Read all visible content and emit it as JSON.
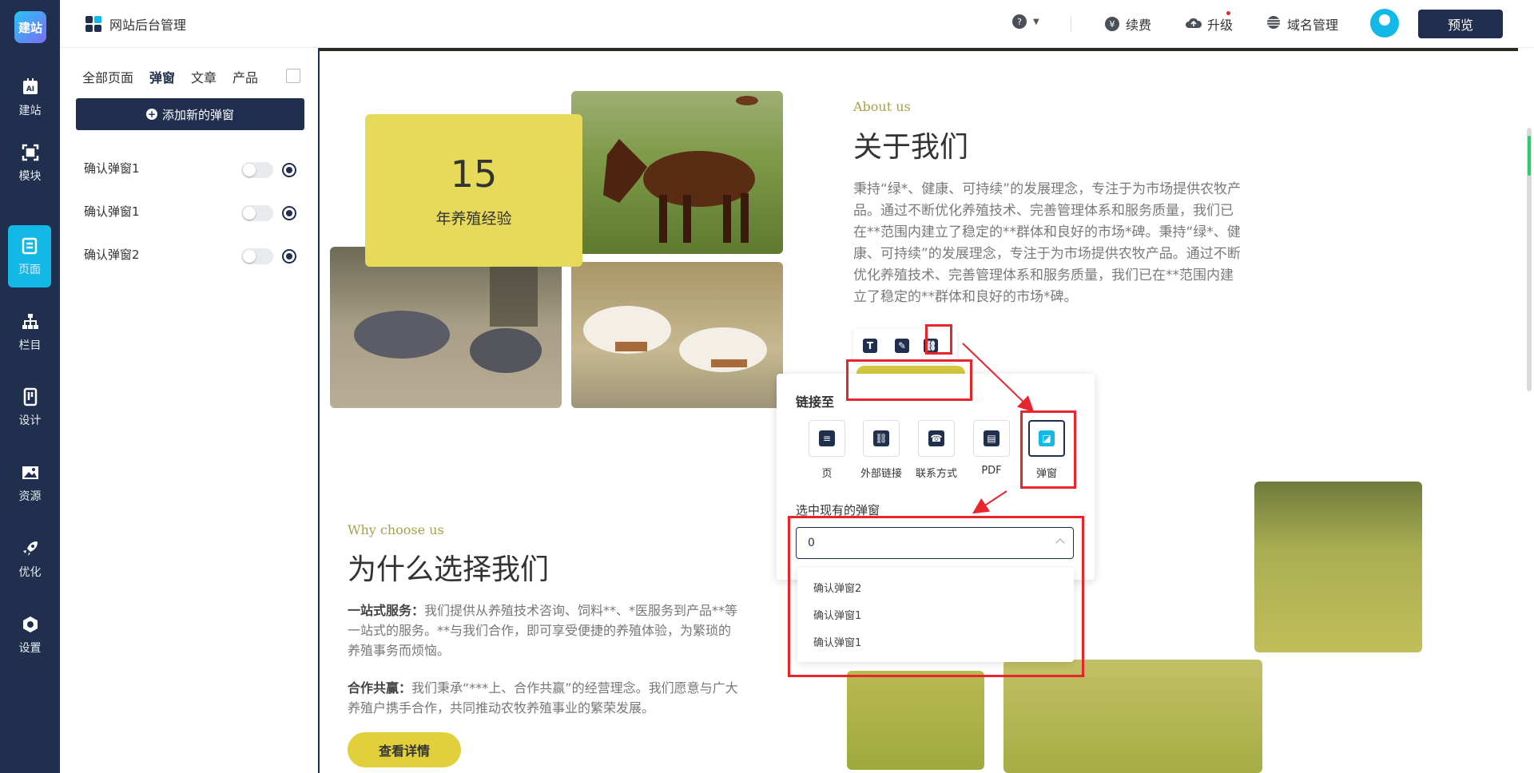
{
  "left_nav": {
    "logo": "建站",
    "items": [
      {
        "label": "建站",
        "icon": "ai-icon"
      },
      {
        "label": "模块",
        "icon": "module-icon"
      },
      {
        "label": "页面",
        "icon": "page-icon",
        "active": true
      },
      {
        "label": "栏目",
        "icon": "sitemap-icon"
      },
      {
        "label": "设计",
        "icon": "design-icon"
      },
      {
        "label": "资源",
        "icon": "image-icon"
      },
      {
        "label": "优化",
        "icon": "rocket-icon"
      },
      {
        "label": "设置",
        "icon": "settings-icon"
      }
    ],
    "ai_glyph": "AI"
  },
  "topbar": {
    "title": "网站后台管理",
    "help": "?",
    "renew": "续费",
    "upgrade": "升级",
    "domain": "域名管理",
    "preview": "预览",
    "renew_glyph": "¥"
  },
  "panel": {
    "tabs": [
      "全部页面",
      "弹窗",
      "文章",
      "产品"
    ],
    "active_tab": "弹窗",
    "add_button": "添加新的弹窗",
    "popups": [
      "确认弹窗1",
      "确认弹窗1",
      "确认弹窗2"
    ]
  },
  "canvas": {
    "years_num": "15",
    "years_label": "年养殖经验",
    "about_en": "About us",
    "about_cn": "关于我们",
    "about_text": "秉持“绿*、健康、可持续”的发展理念，专注于为市场提供农牧产品。通过不断优化养殖技术、完善管理体系和服务质量，我们已在**范围内建立了稳定的**群体和良好的市场*碑。秉持“绿*、健康、可持续”的发展理念，专注于为市场提供农牧产品。通过不断优化养殖技术、完善管理体系和服务质量，我们已在**范围内建立了稳定的**群体和良好的市场*碑。",
    "why_en": "Why choose us",
    "why_cn": "为什么选择我们",
    "why_p1_title": "一站式服务：",
    "why_p1": "我们提供从养殖技术咨询、饲料**、*医服务到产品**等一站式的服务。**与我们合作，即可享受便捷的养殖体验，为繁琐的养殖事务而烦恼。",
    "why_p2_title": "合作共赢：",
    "why_p2": "我们秉承“***上、合作共赢”的经营理念。我们愿意与广大养殖户携手合作，共同推动农牧养殖事业的繁荣发展。",
    "detail_button": "查看详情",
    "toolbar_glyph_text": "T"
  },
  "link_popover": {
    "title": "链接至",
    "options": [
      "页",
      "外部链接",
      "联系方式",
      "PDF",
      "弹窗"
    ],
    "active_option": "弹窗",
    "select_label": "选中现有的弹窗",
    "select_value": "0",
    "dropdown": [
      "确认弹窗2",
      "确认弹窗1",
      "确认弹窗1"
    ]
  },
  "colors": {
    "nav_bg": "#1f2f4d",
    "accent": "#13b9e6",
    "yellow": "#e7d95a",
    "annotation_red": "#e8242c"
  }
}
